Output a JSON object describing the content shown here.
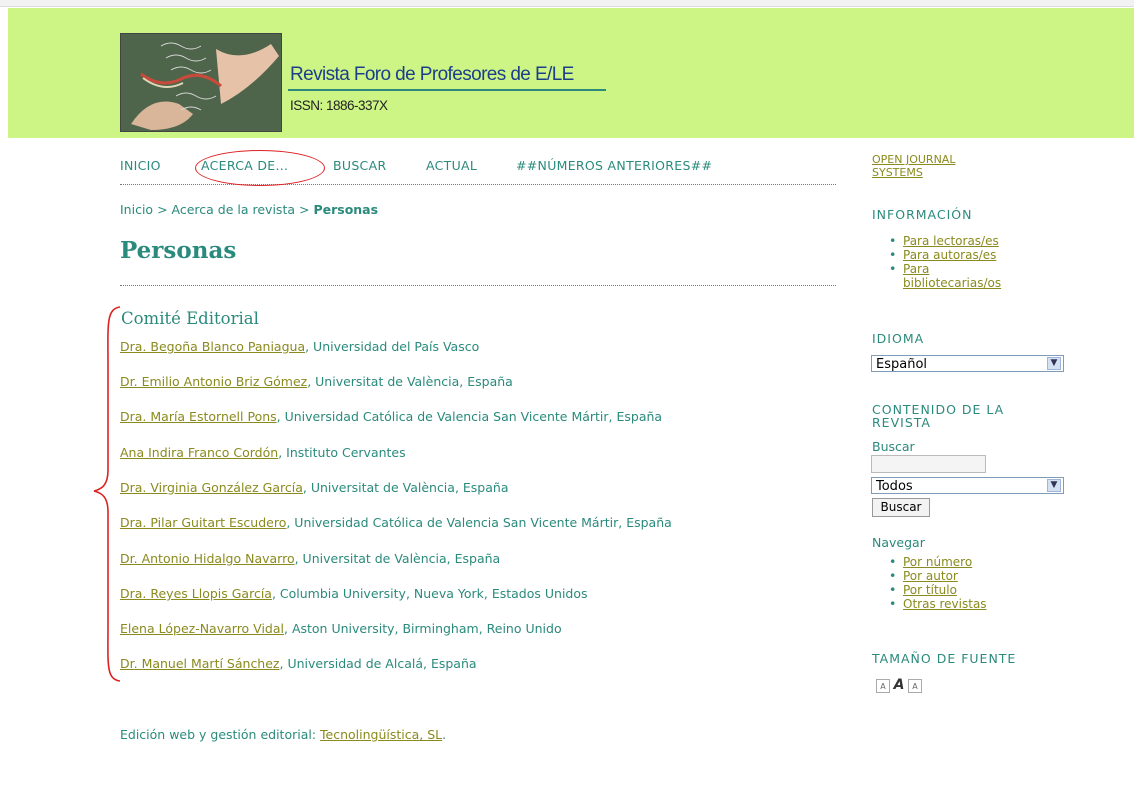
{
  "header": {
    "title": "Revista Foro de Profesores de E/LE",
    "issn": "ISSN: 1886-337X"
  },
  "nav": {
    "items": [
      "INICIO",
      "ACERCA DE...",
      "BUSCAR",
      "ACTUAL",
      "##NÚMEROS ANTERIORES##"
    ]
  },
  "breadcrumb": {
    "home": "Inicio",
    "sep": ">",
    "about": "Acerca de la revista",
    "current": "Personas"
  },
  "page": {
    "title": "Personas",
    "section_title": "Comité Editorial"
  },
  "people": [
    {
      "name": "Dra. Begoña Blanco Paniagua",
      "affiliation": ", Universidad del País Vasco"
    },
    {
      "name": "Dr. Emilio Antonio Briz Gómez",
      "affiliation": ", Universitat de València, España"
    },
    {
      "name": "Dra. María Estornell Pons",
      "affiliation": ", Universidad Católica de Valencia San Vicente Mártir, España"
    },
    {
      "name": "Ana Indira Franco Cordón",
      "affiliation": ", Instituto Cervantes"
    },
    {
      "name": "Dra. Virginia González García",
      "affiliation": ", Universitat de València, España"
    },
    {
      "name": "Dra. Pilar Guitart Escudero",
      "affiliation": ", Universidad Católica de Valencia San Vicente Mártir, España"
    },
    {
      "name": "Dr. Antonio Hidalgo Navarro",
      "affiliation": ", Universitat de València, España"
    },
    {
      "name": "Dra. Reyes Llopis García",
      "affiliation": ", Columbia University, Nueva York, Estados Unidos"
    },
    {
      "name": "Elena López-Navarro Vidal",
      "affiliation": ", Aston University, Birmingham, Reino Unido"
    },
    {
      "name": "Dr. Manuel Martí Sánchez",
      "affiliation": ", Universidad de Alcalá, España"
    }
  ],
  "footer": {
    "text": "Edición web y gestión editorial: ",
    "link": "Tecnolingüística, SL",
    "end": "."
  },
  "sidebar": {
    "ojs_line1": "OPEN JOURNAL",
    "ojs_line2": "SYSTEMS",
    "info_title": "INFORMACIÓN",
    "info_links": [
      "Para lectoras/es",
      "Para autoras/es",
      "Para",
      "bibliotecarias/os"
    ],
    "language_title": "IDIOMA",
    "language_value": "Español",
    "content_title_1": "CONTENIDO DE LA",
    "content_title_2": "REVISTA",
    "search_label": "Buscar",
    "search_scope": "Todos",
    "search_button": "Buscar",
    "browse_label": "Navegar",
    "browse_links": [
      "Por número",
      "Por autor",
      "Por título",
      "Otras revistas"
    ],
    "font_size_title": "TAMAÑO DE FUENTE"
  },
  "colors": {
    "header_bg": "#ccf585",
    "text": "#2a8a7c",
    "link": "#8a8a1e",
    "title_blue": "#1d3f8a",
    "annotation_red": "#d22"
  },
  "icons": {
    "font_small": "font-small-icon",
    "font_default": "font-default-icon",
    "font_large": "font-large-icon",
    "dropdown": "chevron-down-icon"
  }
}
